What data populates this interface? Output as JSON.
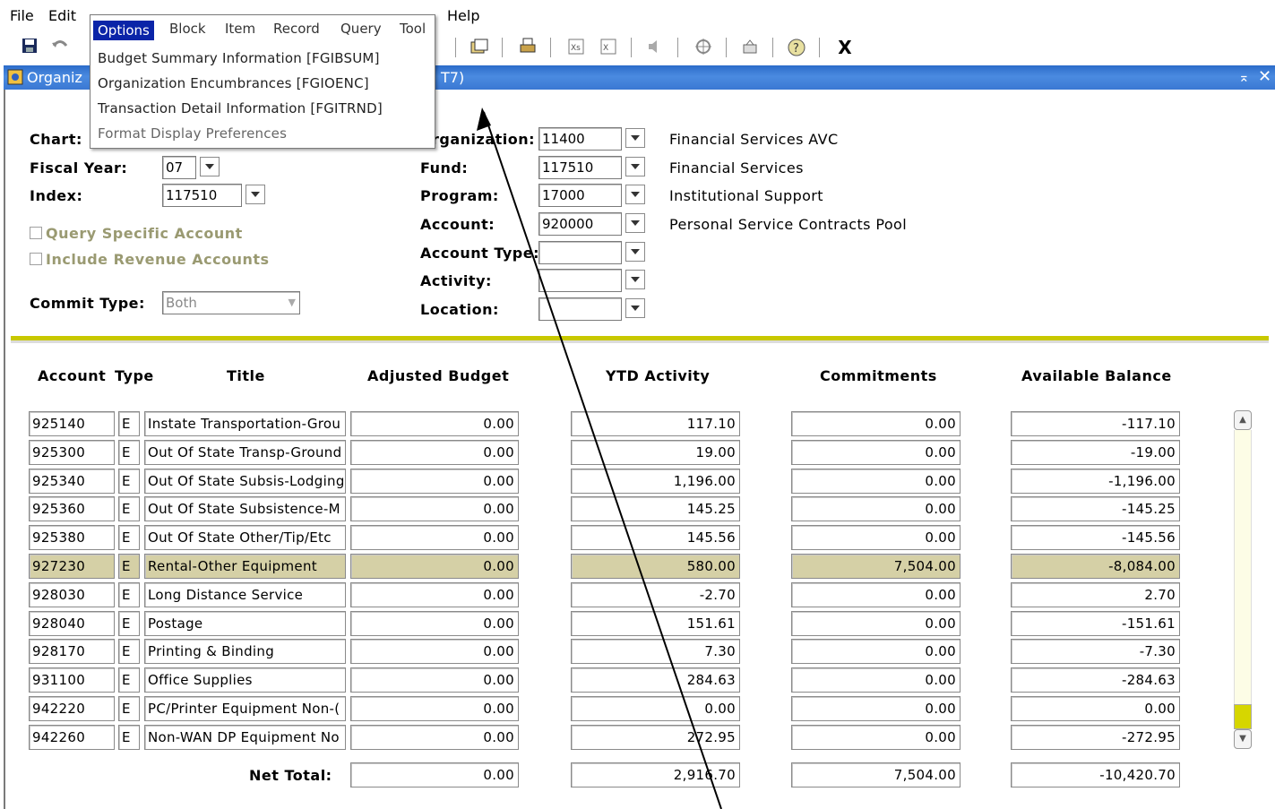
{
  "menubar": {
    "items": [
      {
        "label": "File",
        "ul": "F"
      },
      {
        "label": "Edit",
        "ul": "E"
      },
      {
        "label": "Help",
        "ul": "H"
      }
    ]
  },
  "toolbar": {
    "exit_label": "X"
  },
  "window": {
    "title_left": "Organiz",
    "title_right": "T7)"
  },
  "options_menu": {
    "bar": [
      "Options",
      "Block",
      "Item",
      "Record",
      "Query",
      "Tool"
    ],
    "entries": [
      "Budget Summary Information [FGIBSUM]",
      "Organization Encumbrances [FGIOENC]",
      "Transaction Detail Information [FGITRND]",
      "Format Display Preferences"
    ]
  },
  "form": {
    "chart_label": "Chart:",
    "fiscal_year_label": "Fiscal Year:",
    "fiscal_year_value": "07",
    "index_label": "Index:",
    "index_value": "117510",
    "query_specific_label": "Query Specific Account",
    "include_revenue_label": "Include Revenue Accounts",
    "commit_type_label": "Commit Type:",
    "commit_type_value": "Both",
    "organization_label": "rganization:",
    "organization_value": "11400",
    "organization_desc": "Financial Services AVC",
    "fund_label": "Fund:",
    "fund_value": "117510",
    "fund_desc": "Financial Services",
    "program_label": "Program:",
    "program_value": "17000",
    "program_desc": "Institutional Support",
    "account_label": "Account:",
    "account_value": "920000",
    "account_desc": "Personal Service Contracts Pool",
    "account_type_label": "Account Type:",
    "activity_label": "Activity:",
    "location_label": "Location:"
  },
  "grid": {
    "headers": {
      "account": "Account",
      "type": "Type",
      "title": "Title",
      "adjusted_budget": "Adjusted Budget",
      "ytd_activity": "YTD Activity",
      "commitments": "Commitments",
      "available_balance": "Available Balance"
    },
    "rows": [
      {
        "account": "925140",
        "type": "E",
        "title": "Instate Transportation-Grou",
        "budget": "0.00",
        "ytd": "117.10",
        "commit": "0.00",
        "avail": "-117.10"
      },
      {
        "account": "925300",
        "type": "E",
        "title": "Out Of State Transp-Ground",
        "budget": "0.00",
        "ytd": "19.00",
        "commit": "0.00",
        "avail": "-19.00"
      },
      {
        "account": "925340",
        "type": "E",
        "title": "Out Of State Subsis-Lodging",
        "budget": "0.00",
        "ytd": "1,196.00",
        "commit": "0.00",
        "avail": "-1,196.00"
      },
      {
        "account": "925360",
        "type": "E",
        "title": "Out Of State Subsistence-M",
        "budget": "0.00",
        "ytd": "145.25",
        "commit": "0.00",
        "avail": "-145.25"
      },
      {
        "account": "925380",
        "type": "E",
        "title": "Out Of State Other/Tip/Etc",
        "budget": "0.00",
        "ytd": "145.56",
        "commit": "0.00",
        "avail": "-145.56"
      },
      {
        "account": "927230",
        "type": "E",
        "title": "Rental-Other Equipment",
        "budget": "0.00",
        "ytd": "580.00",
        "commit": "7,504.00",
        "avail": "-8,084.00"
      },
      {
        "account": "928030",
        "type": "E",
        "title": "Long Distance Service",
        "budget": "0.00",
        "ytd": "-2.70",
        "commit": "0.00",
        "avail": "2.70"
      },
      {
        "account": "928040",
        "type": "E",
        "title": "Postage",
        "budget": "0.00",
        "ytd": "151.61",
        "commit": "0.00",
        "avail": "-151.61"
      },
      {
        "account": "928170",
        "type": "E",
        "title": "Printing & Binding",
        "budget": "0.00",
        "ytd": "7.30",
        "commit": "0.00",
        "avail": "-7.30"
      },
      {
        "account": "931100",
        "type": "E",
        "title": "Office Supplies",
        "budget": "0.00",
        "ytd": "284.63",
        "commit": "0.00",
        "avail": "-284.63"
      },
      {
        "account": "942220",
        "type": "E",
        "title": "PC/Printer Equipment Non-(",
        "budget": "0.00",
        "ytd": "0.00",
        "commit": "0.00",
        "avail": "0.00"
      },
      {
        "account": "942260",
        "type": "E",
        "title": "Non-WAN DP Equipment No",
        "budget": "0.00",
        "ytd": "272.95",
        "commit": "0.00",
        "avail": "-272.95"
      }
    ],
    "selected_row_index": 5,
    "net_total_label": "Net Total:",
    "net_totals": {
      "budget": "0.00",
      "ytd": "2,916.70",
      "commit": "7,504.00",
      "avail": "-10,420.70"
    }
  },
  "colors": {
    "title_bar": "#3a78d3",
    "divider": "#c8c800",
    "selected_row": "#d5d0a6",
    "menu_highlight": "#0a24a8"
  }
}
